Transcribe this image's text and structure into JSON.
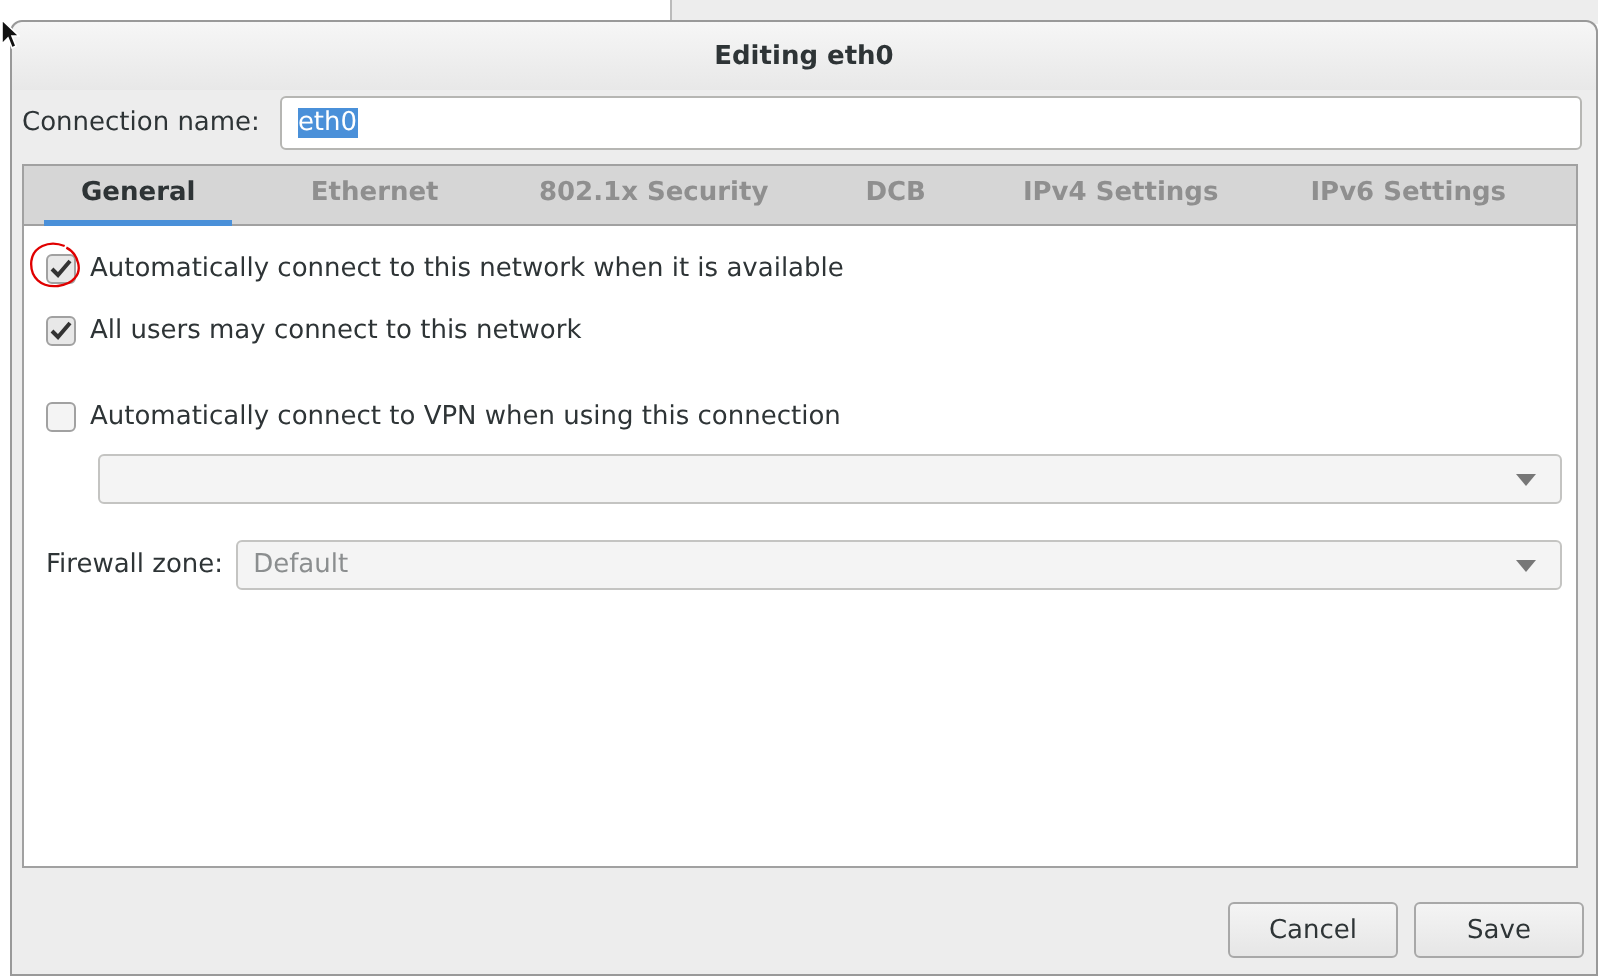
{
  "window": {
    "title": "Editing eth0"
  },
  "connection_name": {
    "label": "Connection name:",
    "value": "eth0"
  },
  "tabs": [
    {
      "label": "General",
      "selected": true
    },
    {
      "label": "Ethernet",
      "selected": false
    },
    {
      "label": "802.1x Security",
      "selected": false
    },
    {
      "label": "DCB",
      "selected": false
    },
    {
      "label": "IPv4 Settings",
      "selected": false
    },
    {
      "label": "IPv6 Settings",
      "selected": false
    }
  ],
  "options": [
    {
      "label": "Automatically connect to this network when it is available",
      "checked": true,
      "annotated": true
    },
    {
      "label": "All users may connect to this network",
      "checked": true,
      "annotated": false
    },
    {
      "label": "Automatically connect to VPN when using this connection",
      "checked": false,
      "annotated": false
    }
  ],
  "vpn_dropdown": {
    "disabled": true
  },
  "firewall_zone": {
    "label": "Firewall zone:",
    "value": "Default",
    "disabled": true
  },
  "buttons": [
    {
      "label": "Cancel"
    },
    {
      "label": "Save"
    }
  ]
}
